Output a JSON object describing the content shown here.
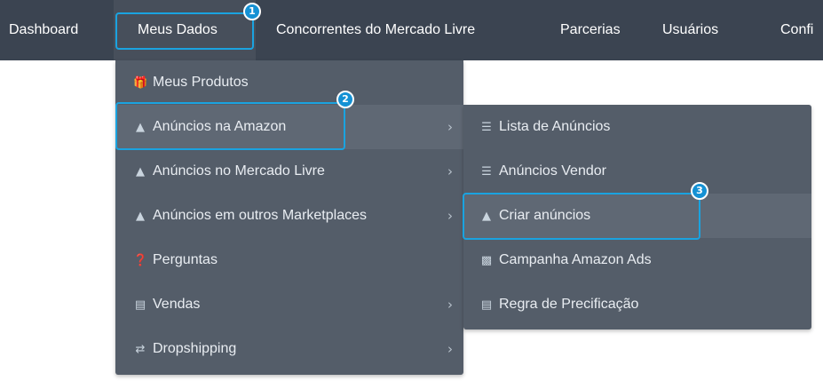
{
  "navbar": {
    "items": [
      {
        "label": "Dashboard"
      },
      {
        "label": "Meus Dados"
      },
      {
        "label": "Concorrentes do Mercado Livre"
      },
      {
        "label": "Parcerias"
      },
      {
        "label": "Usuários"
      },
      {
        "label": "Confi"
      }
    ]
  },
  "badges": [
    "1",
    "2",
    "3"
  ],
  "menu": {
    "items": [
      {
        "label": "Meus Produtos",
        "icon": "gift-icon"
      },
      {
        "label": "Anúncios na Amazon",
        "icon": "upload-icon",
        "submenu": true
      },
      {
        "label": "Anúncios no Mercado Livre",
        "icon": "upload-icon",
        "submenu": true
      },
      {
        "label": "Anúncios em outros Marketplaces",
        "icon": "upload-icon",
        "submenu": true
      },
      {
        "label": "Perguntas",
        "icon": "question-circle-icon"
      },
      {
        "label": "Vendas",
        "icon": "cart-icon",
        "submenu": true
      },
      {
        "label": "Dropshipping",
        "icon": "retweet-icon",
        "submenu": true
      }
    ]
  },
  "submenu": {
    "items": [
      {
        "label": "Lista de Anúncios",
        "icon": "list-icon"
      },
      {
        "label": "Anúncios Vendor",
        "icon": "list-icon"
      },
      {
        "label": "Criar anúncios",
        "icon": "upload-icon"
      },
      {
        "label": "Campanha Amazon Ads",
        "icon": "money-icon"
      },
      {
        "label": "Regra de Precificação",
        "icon": "cart-icon"
      }
    ]
  },
  "colors": {
    "navbar": "#3b4451",
    "menu": "#545d69",
    "highlight": "#1aa3e0",
    "badge": "#1591d4"
  }
}
